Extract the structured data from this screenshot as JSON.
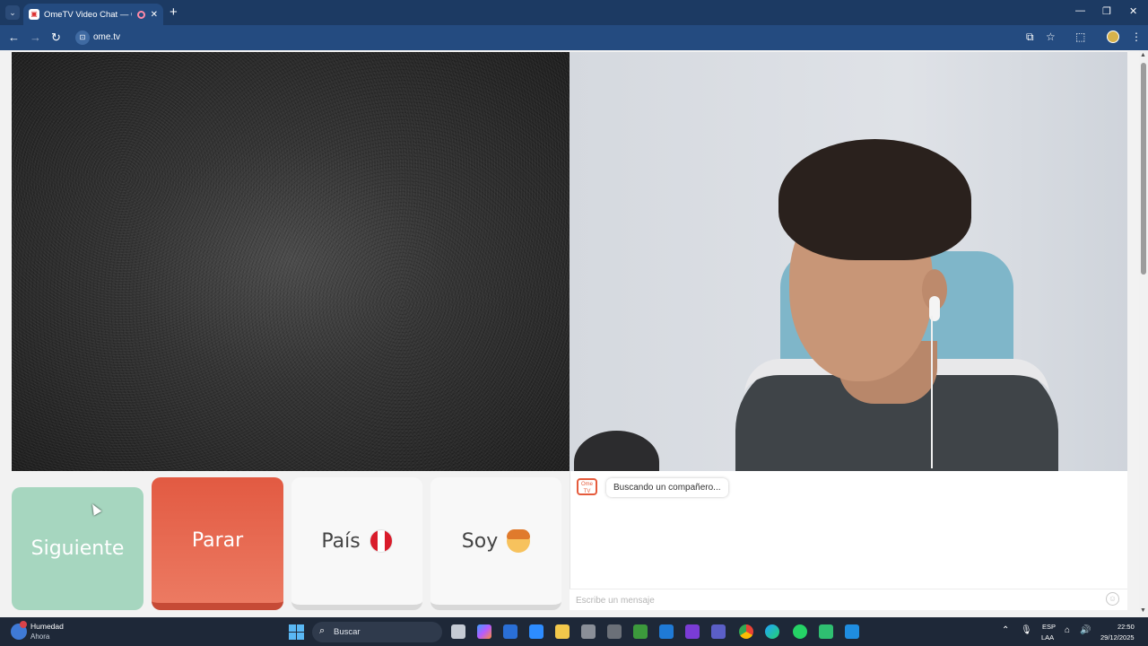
{
  "browser": {
    "tab_title": "OmeTV Video Chat — Ome",
    "url": "ome.tv",
    "icons": [
      "tab-search-icon",
      "close-icon",
      "new-tab-icon",
      "back-icon",
      "forward-icon",
      "reload-icon",
      "site-info-icon",
      "install-icon",
      "star-icon",
      "extensions-icon",
      "profile-icon",
      "menu-icon",
      "minimize-icon",
      "maximize-icon",
      "window-close-icon"
    ]
  },
  "controls": {
    "next_label": "Siguiente",
    "stop_label": "Parar",
    "country_label": "País",
    "gender_label": "Soy",
    "stop_color": "#e25a42",
    "next_color": "#a6d6bf"
  },
  "chat": {
    "logo_text": "Ome TV",
    "status_message": "Buscando un compañero...",
    "input_placeholder": "Escribe un mensaje"
  },
  "taskbar": {
    "weather_title": "Humedad",
    "weather_subtitle": "Ahora",
    "search_label": "Buscar",
    "lang_top": "ESP",
    "lang_bottom": "LAA",
    "time": "22:50",
    "date": "29/12/2025"
  }
}
